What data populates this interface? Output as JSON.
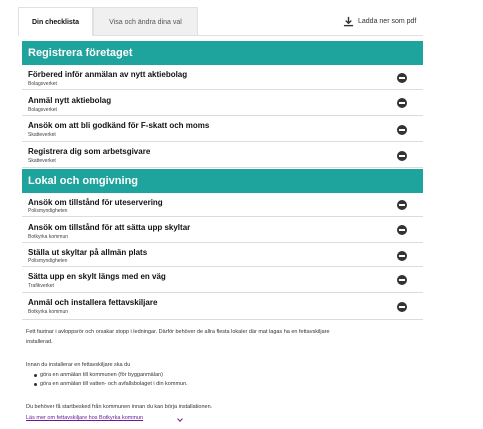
{
  "tabs": [
    {
      "label": "Din checklista",
      "active": true
    },
    {
      "label": "Visa och ändra dina val",
      "active": false
    }
  ],
  "download": {
    "label": "Ladda ner som pdf",
    "icon": "download-icon"
  },
  "sections": [
    {
      "title": "Registrera företaget",
      "items": [
        {
          "title": "Förbered inför anmälan av nytt aktiebolag",
          "subtitle": "Bolagsverket",
          "icon": "minus-circle-icon"
        },
        {
          "title": "Anmäl nytt aktiebolag",
          "subtitle": "Bolagsverket",
          "icon": "minus-circle-icon"
        },
        {
          "title": "Ansök om att bli godkänd för F-skatt och moms",
          "subtitle": "Skatteverket",
          "icon": "minus-circle-icon"
        },
        {
          "title": "Registrera dig som arbetsgivare",
          "subtitle": "Skatteverket",
          "icon": "minus-circle-icon"
        }
      ]
    },
    {
      "title": "Lokal och omgivning",
      "items": [
        {
          "title": "Ansök om tillstånd för uteservering",
          "subtitle": "Polismyndigheten",
          "icon": "minus-circle-icon"
        },
        {
          "title": "Ansök om tillstånd för att sätta upp skyltar",
          "subtitle": "Botkyrka kommun",
          "icon": "minus-circle-icon"
        },
        {
          "title": "Ställa ut skyltar på allmän plats",
          "subtitle": "Polismyndigheten",
          "icon": "minus-circle-icon"
        },
        {
          "title": "Sätta upp en skylt längs med en väg",
          "subtitle": "Trafikverket",
          "icon": "minus-circle-icon"
        },
        {
          "title": "Anmäl och installera fettavskiljare",
          "subtitle": "Botkyrka kommun",
          "icon": "minus-circle-icon",
          "expanded": true
        }
      ]
    }
  ],
  "expanded_detail": {
    "paragraph1_line1": "Fett fastnar i avloppsrör och orsakar stopp i ledningar. Därför behöver de allra flesta lokaler där mat lagas ha en fettavskiljare",
    "paragraph1_line2": "installerad.",
    "paragraph2": "Innan du installerar en fettavskiljare ska du",
    "bullets": [
      "göra en anmälan till kommunen (för bygganmälan)",
      "göra en anmälan till vatten- och avfallsbolaget i din kommun."
    ],
    "paragraph3": "Du behöver få startbesked från kommunen innan du kan börja installationen.",
    "link": "Läs mer om fettavskiljare hos Botkyrka kommun"
  }
}
